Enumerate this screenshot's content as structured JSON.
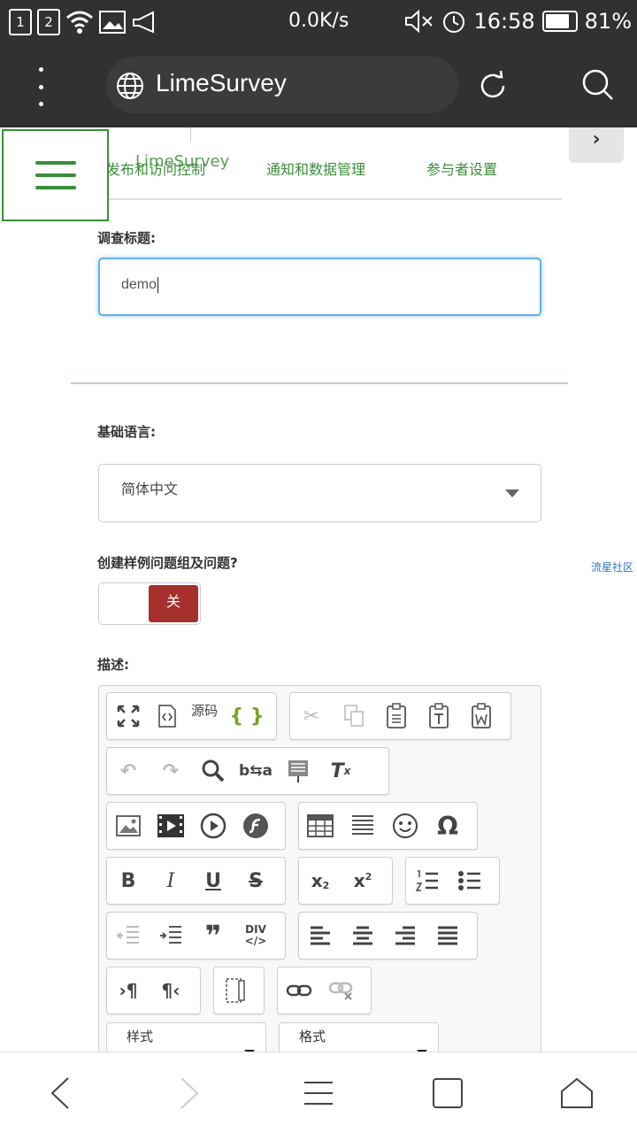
{
  "status_bar": {
    "sim1": "1",
    "sim2": "2",
    "net_speed": "0.0K/s",
    "time": "16:58",
    "battery": "81%",
    "battery_level": 0.81
  },
  "browser": {
    "url_text": "LimeSurvey"
  },
  "survey_nav": {
    "brand": "LimeSurvey",
    "tabs": [
      "发布和访问控制",
      "通知和数据管理",
      "参与者设置"
    ],
    "next_label": "›"
  },
  "form": {
    "title_label": "调查标题:",
    "title_value": "demo",
    "language_label": "基础语言:",
    "language_value": "简体中文",
    "sample_label": "创建样例问题组及问题?",
    "toggle_off_label": "关",
    "description_label": "描述:",
    "source_label": "源码",
    "style_combo": "样式",
    "format_combo": "格式"
  },
  "side_link": "流星社区"
}
